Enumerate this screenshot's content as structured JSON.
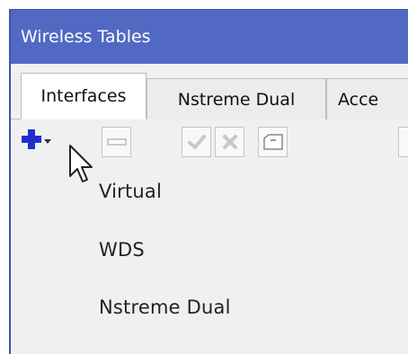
{
  "window": {
    "title": "Wireless Tables"
  },
  "tabs": [
    {
      "label": "Interfaces",
      "active": true
    },
    {
      "label": "Nstreme Dual",
      "active": false
    },
    {
      "label": "Acce",
      "active": false
    }
  ],
  "toolbar": {
    "buttons": [
      {
        "icon": "plus-icon",
        "enabled": true
      },
      {
        "icon": "minus-icon",
        "enabled": false
      },
      {
        "icon": "check-icon",
        "enabled": false
      },
      {
        "icon": "cross-icon",
        "enabled": false
      },
      {
        "icon": "note-icon",
        "enabled": false
      }
    ]
  },
  "dropdown_menu": {
    "items": [
      "Virtual",
      "WDS",
      "Nstreme Dual"
    ]
  },
  "colors": {
    "title_bar": "#5269c4",
    "plus_icon": "#1e2fd0",
    "border": "#bdbdbd",
    "background": "#f0f0f0"
  }
}
